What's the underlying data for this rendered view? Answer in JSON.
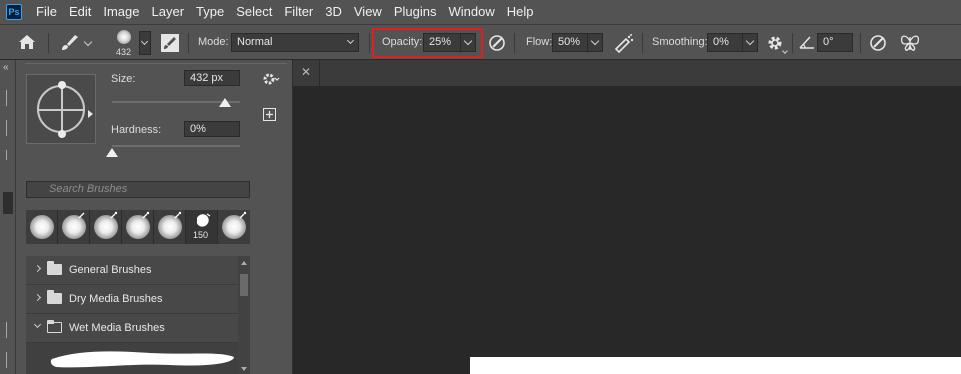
{
  "menu": [
    "File",
    "Edit",
    "Image",
    "Layer",
    "Type",
    "Select",
    "Filter",
    "3D",
    "View",
    "Plugins",
    "Window",
    "Help"
  ],
  "app_logo": "Ps",
  "options": {
    "brush_size_value": "432",
    "mode_label": "Mode:",
    "mode_value": "Normal",
    "opacity_label": "Opacity:",
    "opacity_value": "25%",
    "flow_label": "Flow:",
    "flow_value": "50%",
    "smoothing_label": "Smoothing:",
    "smoothing_value": "0%",
    "angle_value": "0°"
  },
  "brush_panel": {
    "size_label": "Size:",
    "size_value": "432 px",
    "size_fraction": 0.88,
    "hardness_label": "Hardness:",
    "hardness_value": "0%",
    "hardness_fraction": 0.0,
    "search_placeholder": "Search Brushes",
    "tip_count_label": "150",
    "folders": [
      {
        "label": "General Brushes",
        "expanded": false
      },
      {
        "label": "Dry Media Brushes",
        "expanded": false
      },
      {
        "label": "Wet Media Brushes",
        "expanded": true
      }
    ]
  },
  "highlight_color": "#e02020",
  "icons": {
    "home": "home-icon",
    "brush_tool": "brush-icon",
    "panel_toggle": "brush-settings-icon",
    "airbrush": "airbrush-icon",
    "pressure_opacity": "pressure-icon",
    "smoothing_settings": "gear-icon",
    "angle": "angle-icon",
    "symmetry": "butterfly-icon"
  }
}
